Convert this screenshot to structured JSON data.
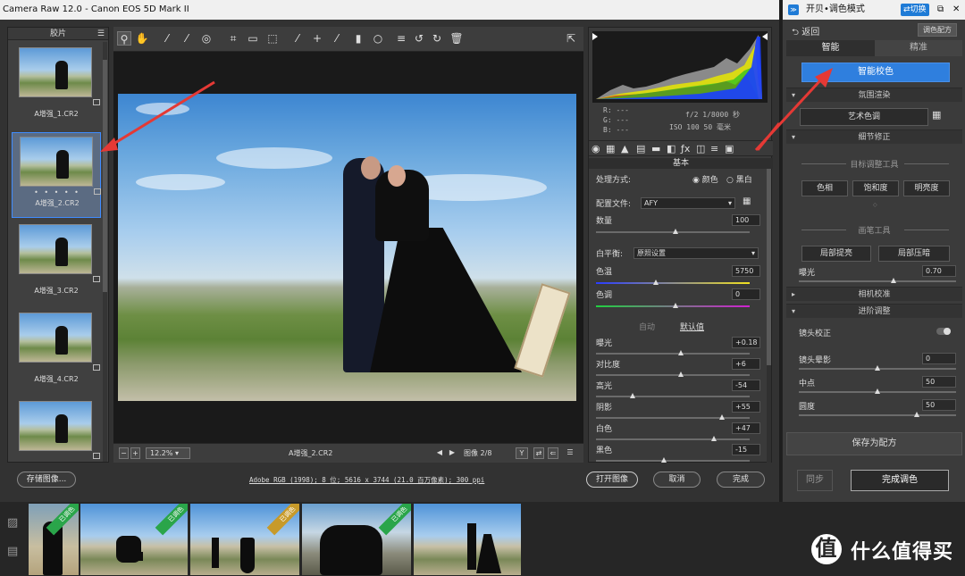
{
  "window": {
    "title": "Camera Raw 12.0 -  Canon EOS 5D Mark II"
  },
  "filmstrip": {
    "header": "胶片",
    "items": [
      {
        "label": "A增强_1.CR2"
      },
      {
        "label": "A增强_2.CR2",
        "dots": "• • • • •"
      },
      {
        "label": "A增强_3.CR2"
      },
      {
        "label": "A增强_4.CR2"
      },
      {
        "label": ""
      }
    ]
  },
  "toolbar": {
    "icons": [
      "zoom-icon",
      "hand-icon",
      "white-balance-icon",
      "color-sampler-icon",
      "target-adjust-icon",
      "crop-icon",
      "straighten-icon",
      "transform-icon",
      "spot-removal-icon",
      "red-eye-icon",
      "brush-icon",
      "graduated-filter-icon",
      "radial-filter-icon",
      "list-icon",
      "rotate-left-icon",
      "rotate-right-icon",
      "trash-icon",
      "fullscreen-icon"
    ]
  },
  "preview": {
    "zoom": "12.2%",
    "filename": "A增强_2.CR2",
    "image_counter": "图像 2/8",
    "y_label": "Y"
  },
  "histogram": {
    "rgb": [
      {
        "k": "R:",
        "v": "---"
      },
      {
        "k": "G:",
        "v": "---"
      },
      {
        "k": "B:",
        "v": "---"
      }
    ],
    "exif_line1": "f/2   1/8000 秒",
    "exif_line2": "ISO 100   50 毫米"
  },
  "basic": {
    "title": "基本",
    "process_label": "处理方式:",
    "process_color": "颜色",
    "process_bw": "黑白",
    "profile_label": "配置文件:",
    "profile_value": "AFY",
    "amount_label": "数量",
    "amount_value": "100",
    "wb_label": "白平衡:",
    "wb_value": "原照设置",
    "temp_label": "色温",
    "temp_value": "5750",
    "tint_label": "色调",
    "tint_value": "0",
    "auto": "自动",
    "default": "默认值",
    "sliders": [
      {
        "label": "曝光",
        "value": "+0.18",
        "pos": 0.55
      },
      {
        "label": "对比度",
        "value": "+6",
        "pos": 0.55
      },
      {
        "label": "高光",
        "value": "-54",
        "pos": 0.24
      },
      {
        "label": "阴影",
        "value": "+55",
        "pos": 0.82
      },
      {
        "label": "白色",
        "value": "+47",
        "pos": 0.77
      },
      {
        "label": "黑色",
        "value": "-15",
        "pos": 0.44
      }
    ]
  },
  "bottom": {
    "save_image": "存储图像...",
    "color_info": "Adobe RGB (1998); 8 位; 5616 x 3744 (21.0 百万像素); 300 ppi",
    "open_image": "打开图像",
    "cancel": "取消",
    "done": "完成"
  },
  "plugin": {
    "title": "开贝•调色模式",
    "switch": "⇄切换",
    "back": "返回",
    "preset_button": "调色配方",
    "tab_smart": "智能",
    "tab_precise": "精准",
    "smart_button": "智能校色",
    "section_atmosphere": "氛围渲染",
    "art_color": "艺术色调",
    "section_detail": "细节修正",
    "target_tool": "目标调整工具",
    "hue": "色相",
    "saturation": "饱和度",
    "lightness": "明亮度",
    "brush_tool": "画笔工具",
    "local_brighten": "局部提亮",
    "local_darken": "局部压暗",
    "exposure_label": "曝光",
    "exposure_value": "0.70",
    "exposure_pos": 0.6,
    "section_camera": "相机校准",
    "section_advanced": "进阶调整",
    "lens_correction": "镜头校正",
    "lens_vignette": "镜头晕影",
    "lens_vignette_value": "0",
    "lens_vignette_pos": 0.5,
    "midpoint": "中点",
    "midpoint_value": "50",
    "midpoint_pos": 0.5,
    "roundness": "圆度",
    "roundness_value": "50",
    "roundness_pos": 0.75,
    "save_preset": "保存为配方",
    "sync": "同步",
    "finish": "完成调色"
  },
  "strip": {
    "items": [
      {
        "ribbon": "已调色"
      },
      {
        "ribbon": "已调色"
      },
      {
        "ribbon": "已调色"
      },
      {
        "ribbon": "已调色"
      },
      {
        "ribbon": ""
      }
    ],
    "watermark_circle": "值",
    "watermark_text": "什么值得买"
  },
  "colors": {
    "accent": "#1f7bd6",
    "selection_border": "#3f8cff",
    "ribbon_green": "#2aa54a",
    "arrow_red": "#e53935"
  }
}
